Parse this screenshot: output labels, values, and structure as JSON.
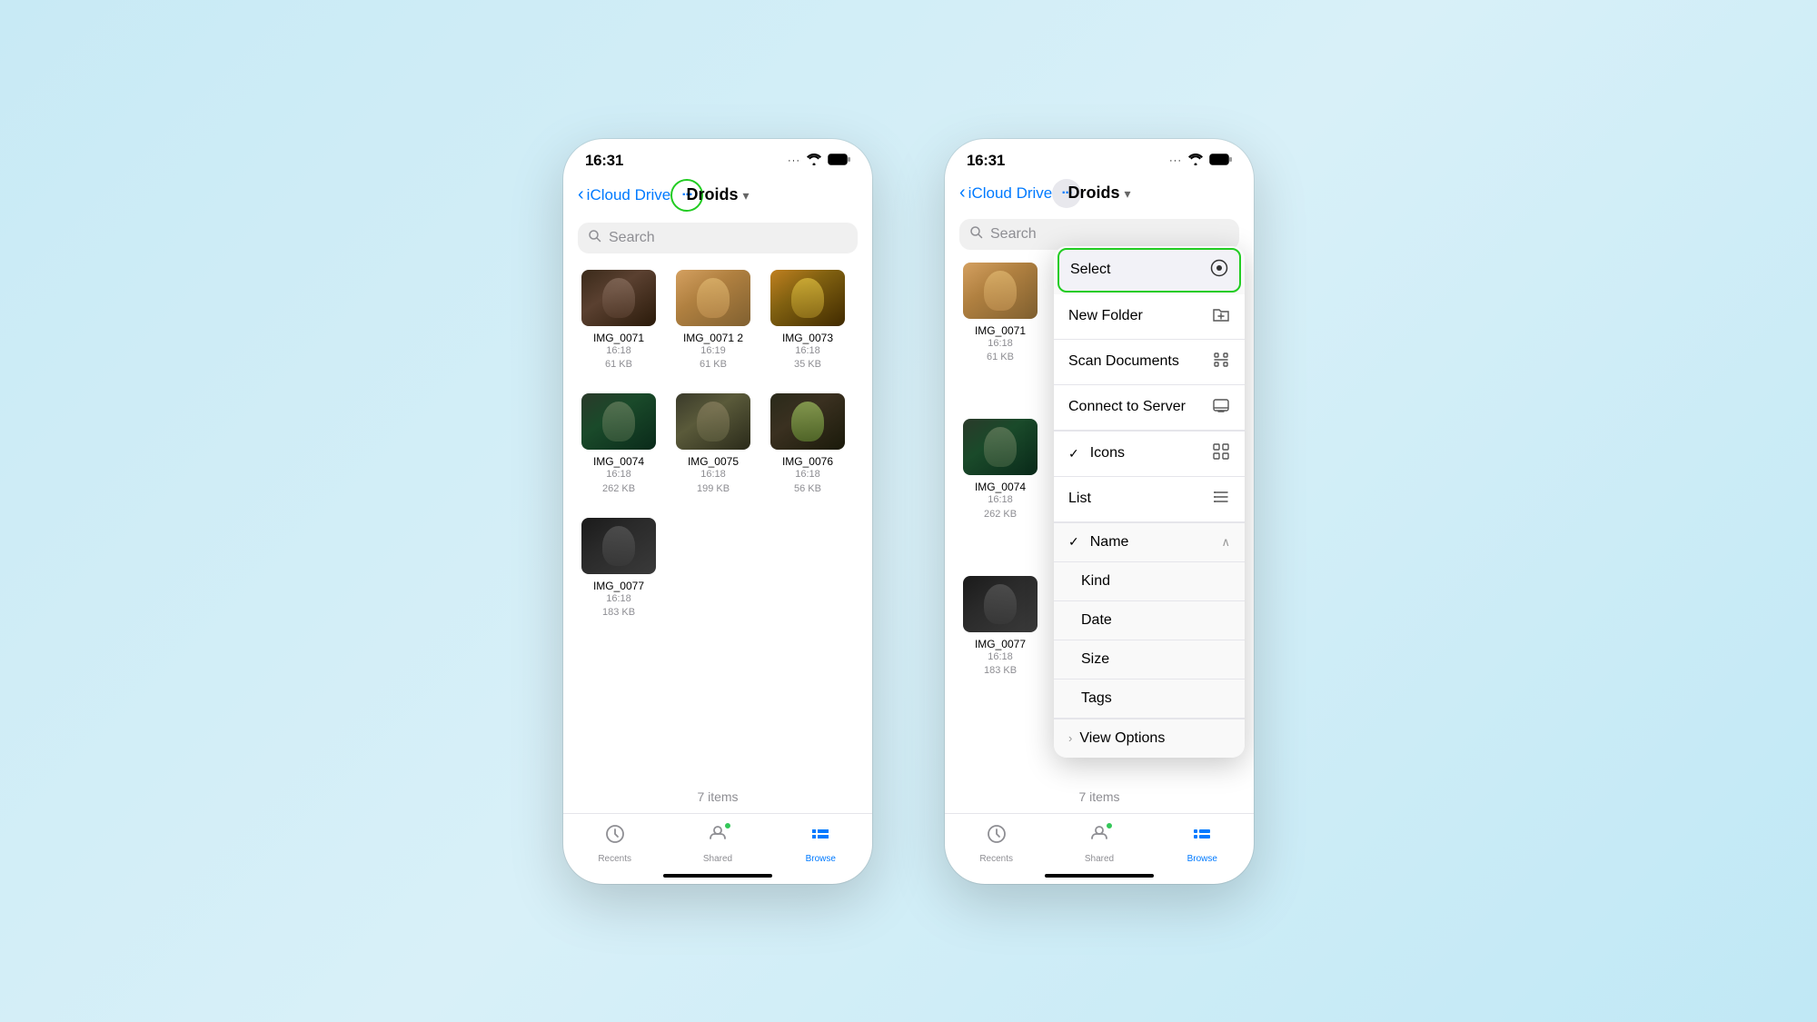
{
  "phone_left": {
    "status_bar": {
      "time": "16:31",
      "signal_dots": "···",
      "wifi": "wifi",
      "battery": "battery"
    },
    "nav": {
      "back_label": "iCloud Drive",
      "title": "Droids",
      "chevron": "▾",
      "more_button_label": "···"
    },
    "search": {
      "placeholder": "Search"
    },
    "files": [
      {
        "name": "IMG_0071",
        "time": "16:18",
        "size": "61 KB",
        "thumb": "d1"
      },
      {
        "name": "IMG_0071 2",
        "time": "16:19",
        "size": "61 KB",
        "thumb": "d2"
      },
      {
        "name": "IMG_0073",
        "time": "16:18",
        "size": "35 KB",
        "thumb": "d3"
      },
      {
        "name": "IMG_0074",
        "time": "16:18",
        "size": "262 KB",
        "thumb": "d4"
      },
      {
        "name": "IMG_0075",
        "time": "16:18",
        "size": "199 KB",
        "thumb": "d5"
      },
      {
        "name": "IMG_0076",
        "time": "16:18",
        "size": "56 KB",
        "thumb": "d6"
      },
      {
        "name": "IMG_0077",
        "time": "16:18",
        "size": "183 KB",
        "thumb": "d7"
      }
    ],
    "footer": {
      "item_count": "7 items"
    },
    "tab_bar": {
      "recents": "Recents",
      "shared": "Shared",
      "browse": "Browse"
    }
  },
  "phone_right": {
    "status_bar": {
      "time": "16:31",
      "signal_dots": "···",
      "wifi": "wifi",
      "battery": "battery"
    },
    "nav": {
      "back_label": "iCloud Drive",
      "title": "Droids",
      "chevron": "▾",
      "more_button_label": "···"
    },
    "search": {
      "placeholder": "Search"
    },
    "dropdown": {
      "select": "Select",
      "select_icon": "⊙",
      "new_folder": "New Folder",
      "new_folder_icon": "folder",
      "scan_documents": "Scan Documents",
      "scan_icon": "scan",
      "connect_to_server": "Connect to Server",
      "server_icon": "monitor",
      "icons_label": "Icons",
      "icons_icon": "grid",
      "icons_checked": true,
      "list_label": "List",
      "list_icon": "list",
      "name_label": "Name",
      "name_checked": true,
      "kind_label": "Kind",
      "date_label": "Date",
      "size_label": "Size",
      "tags_label": "Tags",
      "view_options_label": "View Options",
      "view_options_chevron": ">"
    },
    "files": [
      {
        "name": "IMG_0071",
        "time": "16:18",
        "size": "61 KB",
        "thumb": "d2"
      },
      {
        "name": "IMG_0074",
        "time": "16:18",
        "size": "262 KB",
        "thumb": "d4"
      },
      {
        "name": "IMG_0077",
        "time": "16:18",
        "size": "183 KB",
        "thumb": "d7"
      }
    ],
    "footer": {
      "item_count": "7 items"
    },
    "tab_bar": {
      "recents": "Recents",
      "shared": "Shared",
      "browse": "Browse"
    }
  }
}
